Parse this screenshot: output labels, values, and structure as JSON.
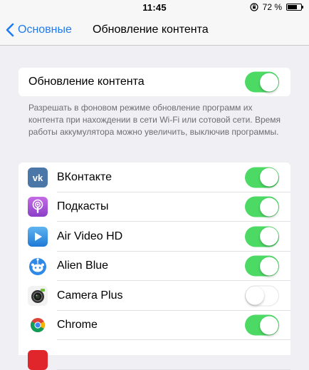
{
  "status_bar": {
    "time": "11:45",
    "battery_text": "72 %",
    "battery_level": 0.72,
    "rotation_lock_icon": "rotation-lock-icon",
    "battery_icon": "battery-icon"
  },
  "nav": {
    "back_label": "Основные",
    "back_icon": "chevron-left-icon",
    "title": "Обновление контента"
  },
  "master": {
    "label": "Обновление контента",
    "enabled": true
  },
  "footer_note": "Разрешать в фоновом режиме обновление программ их контента при нахождении в сети Wi-Fi или сотовой сети. Время работы аккумулятора можно увеличить, выключив программы.",
  "apps": [
    {
      "name": "ВКонтакте",
      "icon": "vk-icon",
      "enabled": true
    },
    {
      "name": "Подкасты",
      "icon": "podcasts-icon",
      "enabled": true
    },
    {
      "name": "Air Video HD",
      "icon": "air-video-icon",
      "enabled": true
    },
    {
      "name": "Alien Blue",
      "icon": "alien-blue-icon",
      "enabled": true
    },
    {
      "name": "Camera Plus",
      "icon": "camera-plus-icon",
      "enabled": false
    },
    {
      "name": "Chrome",
      "icon": "chrome-icon",
      "enabled": true
    }
  ],
  "colors": {
    "accent": "#1e7cf2",
    "toggle_on": "#4cd964",
    "background": "#efeff4"
  }
}
